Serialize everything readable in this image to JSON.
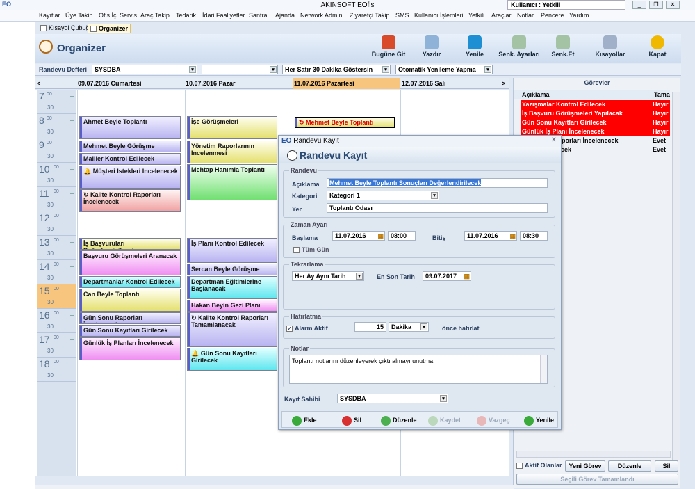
{
  "app": {
    "title": "AKINSOFT EOfis",
    "user": "Kullanıcı : Yetkili",
    "logo": "EO"
  },
  "menu": [
    "Kayıtlar",
    "Üye Takip",
    "Ofis İçi Servis",
    "Araç Takip",
    "Tedarik",
    "İdari Faaliyetler",
    "Santral",
    "Ajanda",
    "Network Admin",
    "Ziyaretçi Takip",
    "SMS",
    "Kullanıcı İşlemleri",
    "Yetkili",
    "Araçlar",
    "Notlar",
    "Pencere",
    "Yardım"
  ],
  "tabs": [
    "Kısayol Çubuğu",
    "Organizer"
  ],
  "header": {
    "title": "Organizer"
  },
  "toolbar": [
    "Bugüne Git",
    "Yazdır",
    "Yenile",
    "Senk. Ayarları",
    "Senk.Et",
    "Kısayollar",
    "Kapat"
  ],
  "filter": {
    "label": "Randevu Defteri",
    "book": "SYSDBA",
    "blank": "",
    "interval": "Her Satır 30 Dakika Göstersin",
    "refresh": "Otomatik Yenileme Yapma"
  },
  "days": [
    "09.07.2016 Cumartesi",
    "10.07.2016 Pazar",
    "11.07.2016 Pazartesi",
    "12.07.2016 Salı"
  ],
  "hours": [
    "7",
    "8",
    "9",
    "10",
    "11",
    "12",
    "13",
    "14",
    "15",
    "16",
    "17",
    "18"
  ],
  "minutes": {
    "top": "00",
    "half": "30"
  },
  "appointments": {
    "d1": [
      "Ahmet Beyle Toplantı",
      "Mehmet Beyle Görüşme",
      "Mailler Kontrol Edilecek",
      "Müşteri İstekleri İncelenecek",
      "Kalite Kontrol Raporları İncelenecek",
      "İş Başvuruları Değerlendirilecek",
      "Başvuru Görüşmeleri Aranacak",
      "Departmanlar Kontrol Edilecek",
      "Can Beyle Toplantı",
      "Gün Sonu Raporları İncelenecek",
      "Gün Sonu Kayıtları Girilecek",
      "Günlük İş Planları İncelenecek"
    ],
    "d2": [
      "İşe Görüşmeleri",
      "Yönetim Raporlarının İncelenmesi",
      "Mehtap Hanımla Toplantı",
      "İş Planı Kontrol Edilecek",
      "Sercan Beyle Görüşme",
      "Departman Eğitimlerine Başlanacak",
      "Hakan Beyin Gezi Planı",
      "Kalite Kontrol Raporları Tamamlanacak",
      "Gün Sonu Kayıtları Girilecek"
    ],
    "d3": [
      "Mehmet Beyle Toplantı"
    ]
  },
  "tasks": {
    "title": "Görevler",
    "col1": "Açıklama",
    "col2": "Tama",
    "rows": [
      {
        "text": "Yazışmalar Kontrol Edilecek",
        "status": "Hayır",
        "red": true
      },
      {
        "text": "İş Başvuru Görüşmeleri Yapılacak",
        "status": "Hayır",
        "red": true
      },
      {
        "text": "Gün Sonu Kayıtları Girilecek",
        "status": "Hayır",
        "red": true
      },
      {
        "text": "Günlük İş Planı İncelenecek",
        "status": "Hayır",
        "red": true
      },
      {
        "text": "Gün Sonu Raporları İncelenecek",
        "status": "Evet",
        "red": false
      },
      {
        "text": "Kontrol Edilecek",
        "status": "Evet",
        "red": false
      }
    ],
    "active_only": "Aktif Olanlar",
    "new": "Yeni Görev",
    "edit": "Düzenle",
    "delete": "Sil",
    "complete": "Seçili Görev Tamamlandı"
  },
  "dialog": {
    "window_title": "Randevu Kayıt",
    "title": "Randevu Kayıt",
    "grp_randevu": "Randevu",
    "lbl_desc": "Açıklama",
    "desc": "Mehmet Beyle Toplantı Sonuçları Değerlendirilecek",
    "lbl_cat": "Kategori",
    "cat": "Kategori 1",
    "lbl_place": "Yer",
    "place": "Toplantı Odası",
    "grp_time": "Zaman Ayarı",
    "lbl_start": "Başlama",
    "start_date": "11.07.2016",
    "start_time": "08:00",
    "lbl_end": "Bitiş",
    "end_date": "11.07.2016",
    "end_time": "08:30",
    "all_day": "Tüm Gün",
    "grp_repeat": "Tekrarlama",
    "repeat": "Her Ay Aynı Tarih",
    "lbl_last": "En Son Tarih",
    "last_date": "09.07.2017",
    "grp_remind": "Hatırlatma",
    "alarm": "Alarm Aktif",
    "alarm_val": "15",
    "alarm_unit": "Dakika",
    "alarm_after": "önce hatırlat",
    "grp_notes": "Notlar",
    "notes": "Toplantı notlarını düzenleyerek çıktı almayı unutma.",
    "lbl_owner": "Kayıt Sahibi",
    "owner": "SYSDBA",
    "buttons": [
      "Ekle",
      "Sil",
      "Düzenle",
      "Kaydet",
      "Vazgeç",
      "Yenile"
    ]
  },
  "colors": {
    "accent": "#2b4a73",
    "red": "#ff0000"
  }
}
